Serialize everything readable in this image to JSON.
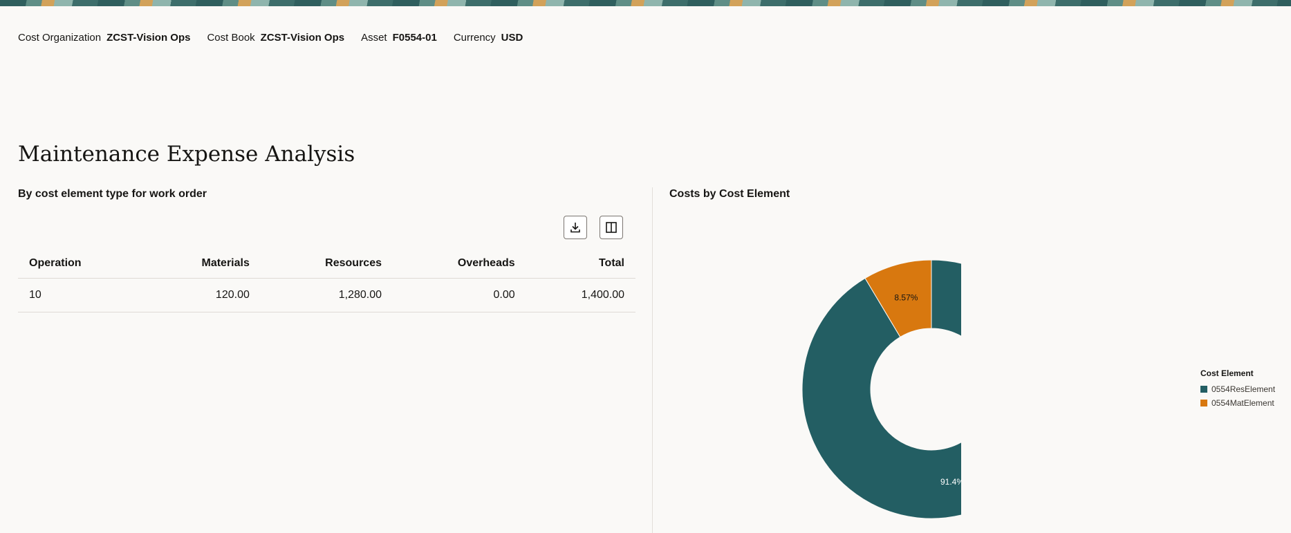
{
  "context": {
    "items": [
      {
        "label": "Cost Organization",
        "value": "ZCST-Vision Ops"
      },
      {
        "label": "Cost Book",
        "value": "ZCST-Vision Ops"
      },
      {
        "label": "Asset",
        "value": "F0554-01"
      },
      {
        "label": "Currency",
        "value": "USD"
      }
    ]
  },
  "page": {
    "title": "Maintenance Expense Analysis"
  },
  "table_section": {
    "heading": "By cost element type for work order",
    "toolbar": {
      "download_icon": "download-icon",
      "columns_icon": "columns-icon"
    },
    "columns": [
      "Operation",
      "Materials",
      "Resources",
      "Overheads",
      "Total"
    ],
    "rows": [
      [
        "10",
        "120.00",
        "1,280.00",
        "0.00",
        "1,400.00"
      ]
    ]
  },
  "chart_section": {
    "heading": "Costs by Cost Element"
  },
  "chart_data": {
    "type": "pie",
    "donut": true,
    "legend_title": "Cost Element",
    "legend_position": "right",
    "slices": [
      {
        "label": "0554ResElement",
        "value": 91.4,
        "display": "91.4%",
        "color": "#235e63"
      },
      {
        "label": "0554MatElement",
        "value": 8.57,
        "display": "8.57%",
        "color": "#d8780f"
      }
    ]
  }
}
